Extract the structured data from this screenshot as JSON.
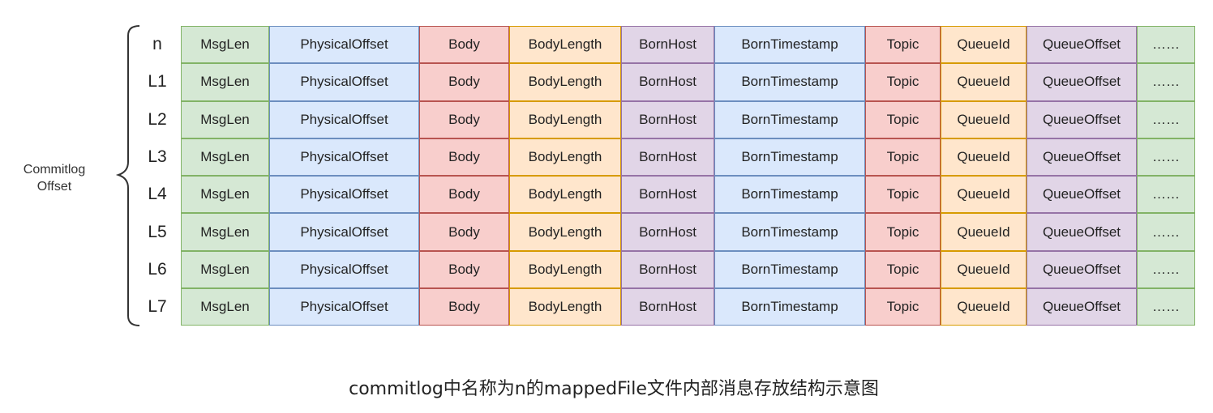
{
  "diagram": {
    "side_label": [
      "Commitlog",
      "Offset"
    ],
    "row_labels": [
      "n",
      "L1",
      "L2",
      "L3",
      "L4",
      "L5",
      "L6",
      "L7"
    ],
    "columns": [
      {
        "label": "MsgLen",
        "fill": "#d5e8d4",
        "stroke": "#82b366"
      },
      {
        "label": "PhysicalOffset",
        "fill": "#dae8fc",
        "stroke": "#6c8ebf"
      },
      {
        "label": "Body",
        "fill": "#f8cecc",
        "stroke": "#b85450"
      },
      {
        "label": "BodyLength",
        "fill": "#ffe6cc",
        "stroke": "#d79b00"
      },
      {
        "label": "BornHost",
        "fill": "#e1d5e7",
        "stroke": "#9673a6"
      },
      {
        "label": "BornTimestamp",
        "fill": "#dae8fc",
        "stroke": "#6c8ebf"
      },
      {
        "label": "Topic",
        "fill": "#f8cecc",
        "stroke": "#b85450"
      },
      {
        "label": "QueueId",
        "fill": "#ffe6cc",
        "stroke": "#d79b00"
      },
      {
        "label": "QueueOffset",
        "fill": "#e1d5e7",
        "stroke": "#9673a6"
      },
      {
        "label": "……",
        "fill": "#d5e8d4",
        "stroke": "#82b366"
      }
    ],
    "caption": "commitlog中名称为n的mappedFile文件内部消息存放结构示意图"
  }
}
